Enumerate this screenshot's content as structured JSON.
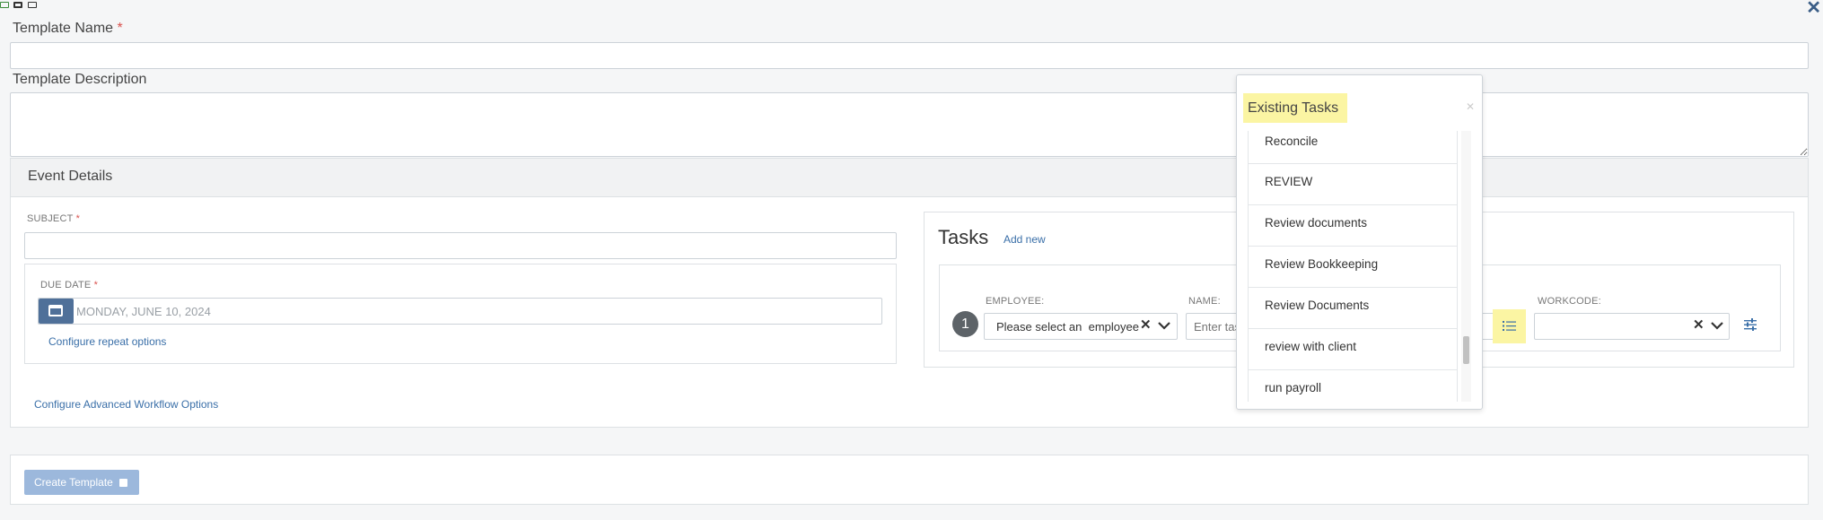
{
  "toolbar": {
    "icons": [
      "window-icon",
      "window-icon",
      "window-icon"
    ],
    "close_icon": "✕"
  },
  "template": {
    "name_label": "Template Name",
    "name_value": "",
    "description_label": "Template Description",
    "description_value": "",
    "required_mark": "*"
  },
  "event": {
    "header": "Event Details",
    "subject_label": "SUBJECT",
    "subject_value": "",
    "due_date_label": "DUE DATE",
    "due_date_placeholder": "MONDAY, JUNE 10, 2024",
    "repeat_link": "Configure repeat options",
    "advanced_link": "Configure Advanced Workflow Options"
  },
  "tasks": {
    "title": "Tasks",
    "add_new": "Add new",
    "row": {
      "number": "1",
      "employee_label": "EMPLOYEE:",
      "employee_value": "Please select an  employee",
      "name_label": "NAME:",
      "name_placeholder": "Enter task name",
      "workcode_label": "WORKCODE:",
      "workcode_value": ""
    }
  },
  "dropdown": {
    "header": "Existing Tasks",
    "items": [
      "Reconcile",
      "REVIEW",
      "Review documents",
      "Review Bookkeeping",
      "Review Documents",
      "review with client",
      "run payroll"
    ]
  },
  "footer": {
    "create_button": "Create Template"
  },
  "colors": {
    "accent": "#3a6fa8",
    "highlight": "#fbf5a3",
    "calendar": "#4f7099",
    "button_disabled": "#9cb8dc"
  }
}
